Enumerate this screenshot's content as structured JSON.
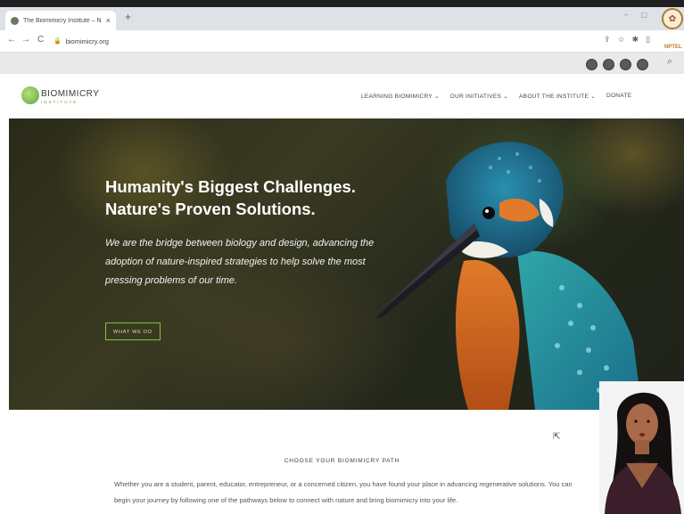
{
  "browser": {
    "tab_title": "The Biomimicry Institute – Nat",
    "tab_close": "×",
    "new_tab": "+",
    "back": "←",
    "forward": "→",
    "reload": "C",
    "url": "biomimicry.org"
  },
  "header": {
    "logo_text": "BIOMIMICRY",
    "logo_sub": "INSTITUTE",
    "nav": [
      {
        "label": "LEARNING BIOMIMICRY  ⌄"
      },
      {
        "label": "OUR INITIATIVES  ⌄"
      },
      {
        "label": "ABOUT THE INSTITUTE  ⌄"
      },
      {
        "label": "DONATE"
      }
    ]
  },
  "hero": {
    "title_line1": "Humanity's Biggest Challenges.",
    "title_line2": "Nature's Proven Solutions.",
    "copy": "We are the bridge between biology and design, advancing the adoption of nature-inspired strategies to help solve the most pressing problems of our time.",
    "button": "WHAT WE DO"
  },
  "path_section": {
    "title": "CHOOSE YOUR BIOMIMICRY PATH",
    "copy": "Whether you are a student, parent, educator, entrepreneur, or a concerned citizen, you have found your place in advancing regenerative solutions. You can begin your journey by following one of the pathways below to connect with nature and bring biomimicry into your life."
  },
  "nptel": {
    "label": "NPTEL"
  },
  "colors": {
    "accent_green": "#7dc43a",
    "hero_bg": "#2a2a1a"
  }
}
